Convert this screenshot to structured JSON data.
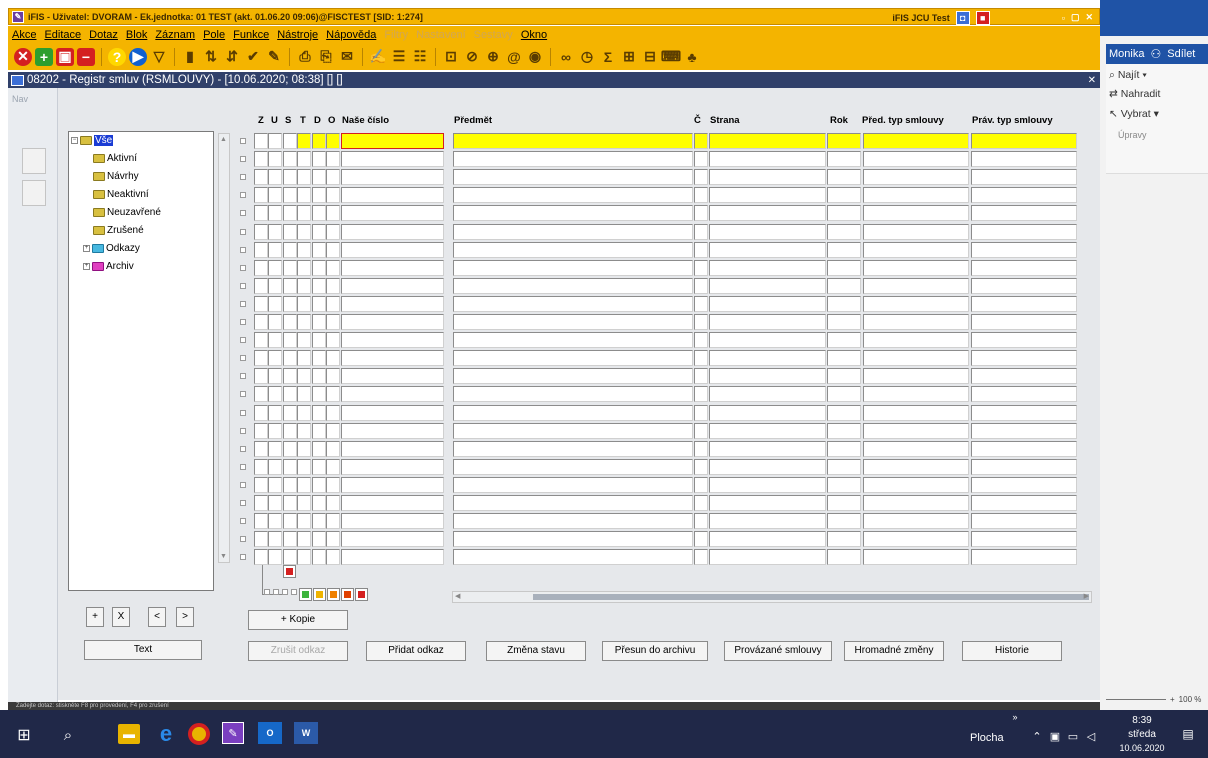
{
  "window": {
    "title": "iFIS - Uživatel: DVORAM - Ek.jednotka: 01 TEST (akt. 01.06.20 09:06)@FISCTEST [SID: 1:274]",
    "right_label": "iFIS JCU Test"
  },
  "menu": [
    {
      "label": "Akce",
      "enabled": true
    },
    {
      "label": "Editace",
      "enabled": true
    },
    {
      "label": "Dotaz",
      "enabled": true
    },
    {
      "label": "Blok",
      "enabled": true
    },
    {
      "label": "Záznam",
      "enabled": true
    },
    {
      "label": "Pole",
      "enabled": true
    },
    {
      "label": "Funkce",
      "enabled": true
    },
    {
      "label": "Nástroje",
      "enabled": true
    },
    {
      "label": "Nápověda",
      "enabled": true
    },
    {
      "label": "Filtry",
      "enabled": false
    },
    {
      "label": "Nastavení",
      "enabled": false
    },
    {
      "label": "Sestavy",
      "enabled": false
    },
    {
      "label": "Okno",
      "enabled": true
    }
  ],
  "subwindow": {
    "title": "08202 - Registr smluv (RSMLOUVY) - [10.06.2020; 08:38] [] []"
  },
  "nav": {
    "label": "Nav"
  },
  "tree": {
    "root": "Vše",
    "items": [
      "Aktivní",
      "Návrhy",
      "Neaktivní",
      "Neuzavřené",
      "Zrušené",
      "Odkazy",
      "Archiv"
    ]
  },
  "grid": {
    "flag_headers": [
      "Z",
      "U",
      "S",
      "T",
      "D",
      "O"
    ],
    "columns": [
      "Naše číslo",
      "Předmět",
      "Č",
      "Strana",
      "Rok",
      "Před. typ smlouvy",
      "Práv. typ smlouvy"
    ]
  },
  "tree_buttons": {
    "add": "+",
    "delete": "X",
    "prev": "<",
    "next": ">",
    "text": "Text"
  },
  "buttons": {
    "kopie": "+ Kopie",
    "zrusit_odkaz": "Zrušit odkaz",
    "pridat_odkaz": "Přidat odkaz",
    "zmena_stavu": "Změna stavu",
    "presun": "Přesun do archivu",
    "provazane": "Provázané smlouvy",
    "hromadne": "Hromadné změny",
    "historie": "Historie"
  },
  "status": {
    "text": "Zadejte dotaz: stiskněte F8 pro provedení, F4 pro zrušení"
  },
  "office_panel": {
    "user": "Monika",
    "share": "Sdílet",
    "find": "Najít",
    "replace": "Nahradit",
    "select": "Vybrat",
    "group": "Úpravy",
    "zoom": "100 %"
  },
  "taskbar": {
    "desktop": "Plocha",
    "time": "8:39",
    "day": "středa",
    "date": "10.06.2020"
  }
}
